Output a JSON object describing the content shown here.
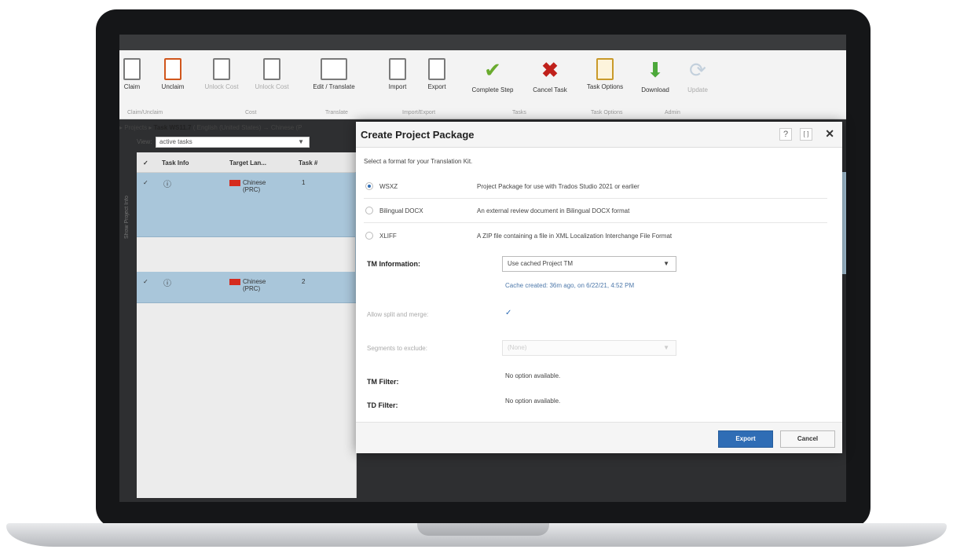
{
  "ribbon": {
    "buttons": [
      "Claim",
      "Unclaim",
      "Unlock Cost",
      "Unlock Cost",
      "Edit / Translate",
      "Import",
      "Export",
      "Complete Step",
      "Cancel Task",
      "Task Options",
      "Download",
      "Update"
    ],
    "groups": [
      "Claim/Unclaim",
      "Cost",
      "Translate",
      "Import/Export",
      "Tasks",
      "Task Options",
      "Admin"
    ]
  },
  "breadcrumb": {
    "prefix": "▸ Projects ▸",
    "task": "Task WS11.7",
    "suffix": "( English (United States) → Chinese (P"
  },
  "view": {
    "label": "View:",
    "value": "active tasks"
  },
  "grid": {
    "headers": [
      "Task Info",
      "Target Lan...",
      "Task #"
    ],
    "rows": [
      {
        "target": "Chinese (PRC)",
        "task_num": "1"
      },
      {
        "target": "Chinese (PRC)",
        "task_num": "2"
      }
    ],
    "side_tab": "Show Project Info"
  },
  "dialog": {
    "title": "Create Project Package",
    "help": "?",
    "maximize": "[ ]",
    "close": "✕",
    "format_prompt": "Select a format for your Translation Kit.",
    "formats": [
      {
        "name": "WSXZ",
        "desc": "Project Package for use with Trados Studio 2021 or earlier",
        "selected": true
      },
      {
        "name": "Bilingual DOCX",
        "desc": "An external review document in Bilingual DOCX format",
        "selected": false
      },
      {
        "name": "XLIFF",
        "desc": "A ZIP file containing a file in XML Localization Interchange File Format",
        "selected": false
      }
    ],
    "tm_info_label": "TM Information:",
    "tm_select_value": "Use cached Project TM",
    "cache_note": "Cache created: 36m ago, on 6/22/21, 4:52 PM",
    "allow_split_label": "Allow split and merge:",
    "allow_split_checked": "✓",
    "segments_label": "Segments to exclude:",
    "segments_value": "(None)",
    "tm_filter_label": "TM Filter:",
    "tm_filter_value": "No option available.",
    "td_filter_label": "TD Filter:",
    "td_filter_value": "No option available.",
    "export_button": "Export",
    "cancel_button": "Cancel"
  },
  "colors": {
    "accent": "#2f6db5",
    "selected_row": "#a9c6da",
    "cancel_icon": "#c0211b",
    "complete_icon": "#6aab2e"
  }
}
